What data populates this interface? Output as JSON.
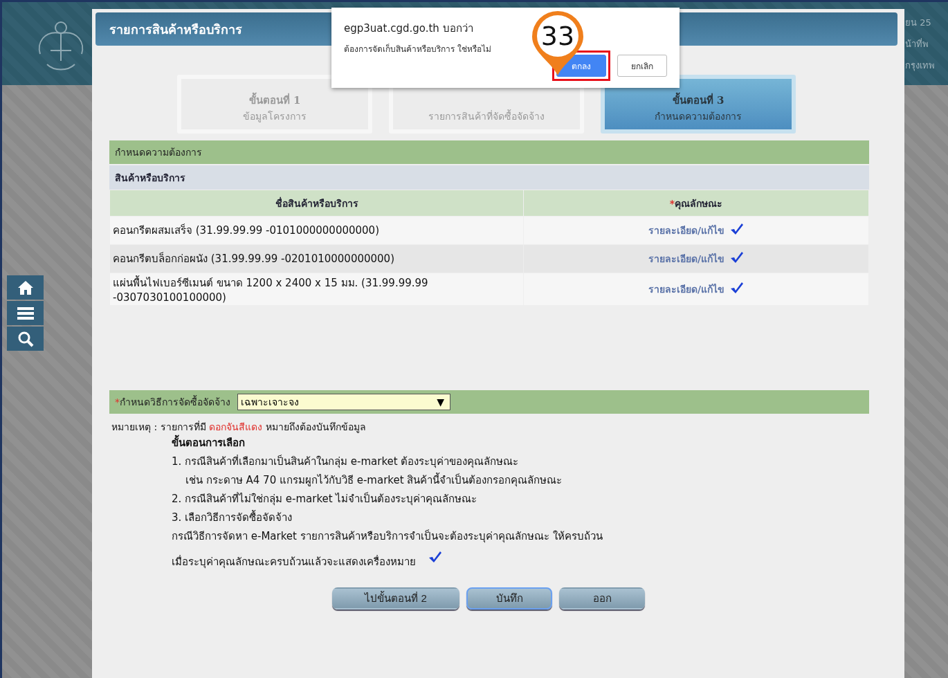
{
  "backdrop": {
    "fragments": [
      "ยน 25",
      "น้าที่พ",
      "กรุงเทพ"
    ]
  },
  "side_nav": [
    {
      "kind": "home"
    },
    {
      "kind": "menu"
    },
    {
      "kind": "search"
    }
  ],
  "modal": {
    "title": "รายการสินค้าหรือบริการ",
    "steps": [
      {
        "title": "ขั้นตอนที่ 1",
        "subtitle": "ข้อมูลโครงการ",
        "selected": false
      },
      {
        "subtitle": "รายการสินค้าที่จัดซื้อจัดจ้าง",
        "selected": false
      },
      {
        "title": "ขั้นตอนที่ 3",
        "subtitle": "กำหนดความต้องการ",
        "selected": true
      }
    ],
    "section_title": "กำหนดความต้องการ",
    "subsection_title": "สินค้าหรือบริการ",
    "table": {
      "columns": [
        {
          "label": "ชื่อสินค้าหรือบริการ"
        },
        {
          "label": "คุณลักษณะ",
          "required_mark": "*"
        }
      ],
      "rows": [
        {
          "name": "คอนกรีตผสมเสร็จ (31.99.99.99 -0101000000000000)",
          "link": "รายละเอียด/แก้ไข",
          "done": true
        },
        {
          "name": "คอนกรีตบล็อกก่อผนัง (31.99.99.99 -0201010000000000)",
          "link": "รายละเอียด/แก้ไข",
          "done": true
        },
        {
          "name": "แผ่นพื้นไฟเบอร์ซีเมนต์ ขนาด 1200 x 2400 x 15 มม. (31.99.99.99 -0307030100100000)",
          "link": "รายละเอียด/แก้ไข",
          "done": true
        }
      ]
    },
    "method": {
      "required_mark": "*",
      "label": "กำหนดวิธีการจัดซื้อจัดจ้าง",
      "value": "เฉพาะเจาะจง",
      "arrow": "▼"
    },
    "note": {
      "prefix": "หมายเหตุ : รายการที่มี",
      "highlight": "ดอกจันสีแดง",
      "suffix": "หมายถึงต้องบันทึกข้อมูล"
    },
    "instructions": {
      "heading": "ขั้นตอนการเลือก",
      "lines": [
        {
          "text": "1. กรณีสินค้าที่เลือกมาเป็นสินค้าในกลุ่ม e-market ต้องระบุค่าของคุณลักษณะ",
          "indent": false
        },
        {
          "text": "เช่น กระดาษ A4 70 แกรมผูกไว้กับวิธี e-market สินค้านี้จำเป็นต้องกรอกคุณลักษณะ",
          "indent": true
        },
        {
          "text": "2. กรณีสินค้าที่ไม่ใช่กลุ่ม e-market ไม่จำเป็นต้องระบุค่าคุณลักษณะ",
          "indent": false
        },
        {
          "text": "3. เลือกวิธีการจัดซื้อจัดจ้าง",
          "indent": false
        },
        {
          "text": "กรณีวิธีการจัดหา e-Market รายการสินค้าหรือบริการจำเป็นจะต้องระบุค่าคุณลักษณะ ให้ครบถ้วน",
          "indent": false
        }
      ],
      "final_line": "เมื่อระบุค่าคุณลักษณะครบถ้วนแล้วจะแสดงเครื่องหมาย"
    },
    "buttons": [
      {
        "label": "ไปขั้นตอนที่ 2",
        "focused": false
      },
      {
        "label": "บันทึก",
        "focused": true
      },
      {
        "label": "ออก",
        "focused": false
      }
    ]
  },
  "dialog": {
    "origin": "egp3uat.cgd.go.th บอกว่า",
    "message": "ต้องการจัดเก็บสินค้าหรือบริการ ใช่หรือไม่",
    "buttons": [
      {
        "label": "ตกลง",
        "primary": true,
        "highlighted": true
      },
      {
        "label": "ยกเลิก",
        "primary": false,
        "highlighted": false
      }
    ]
  },
  "callout": {
    "number": "33"
  }
}
